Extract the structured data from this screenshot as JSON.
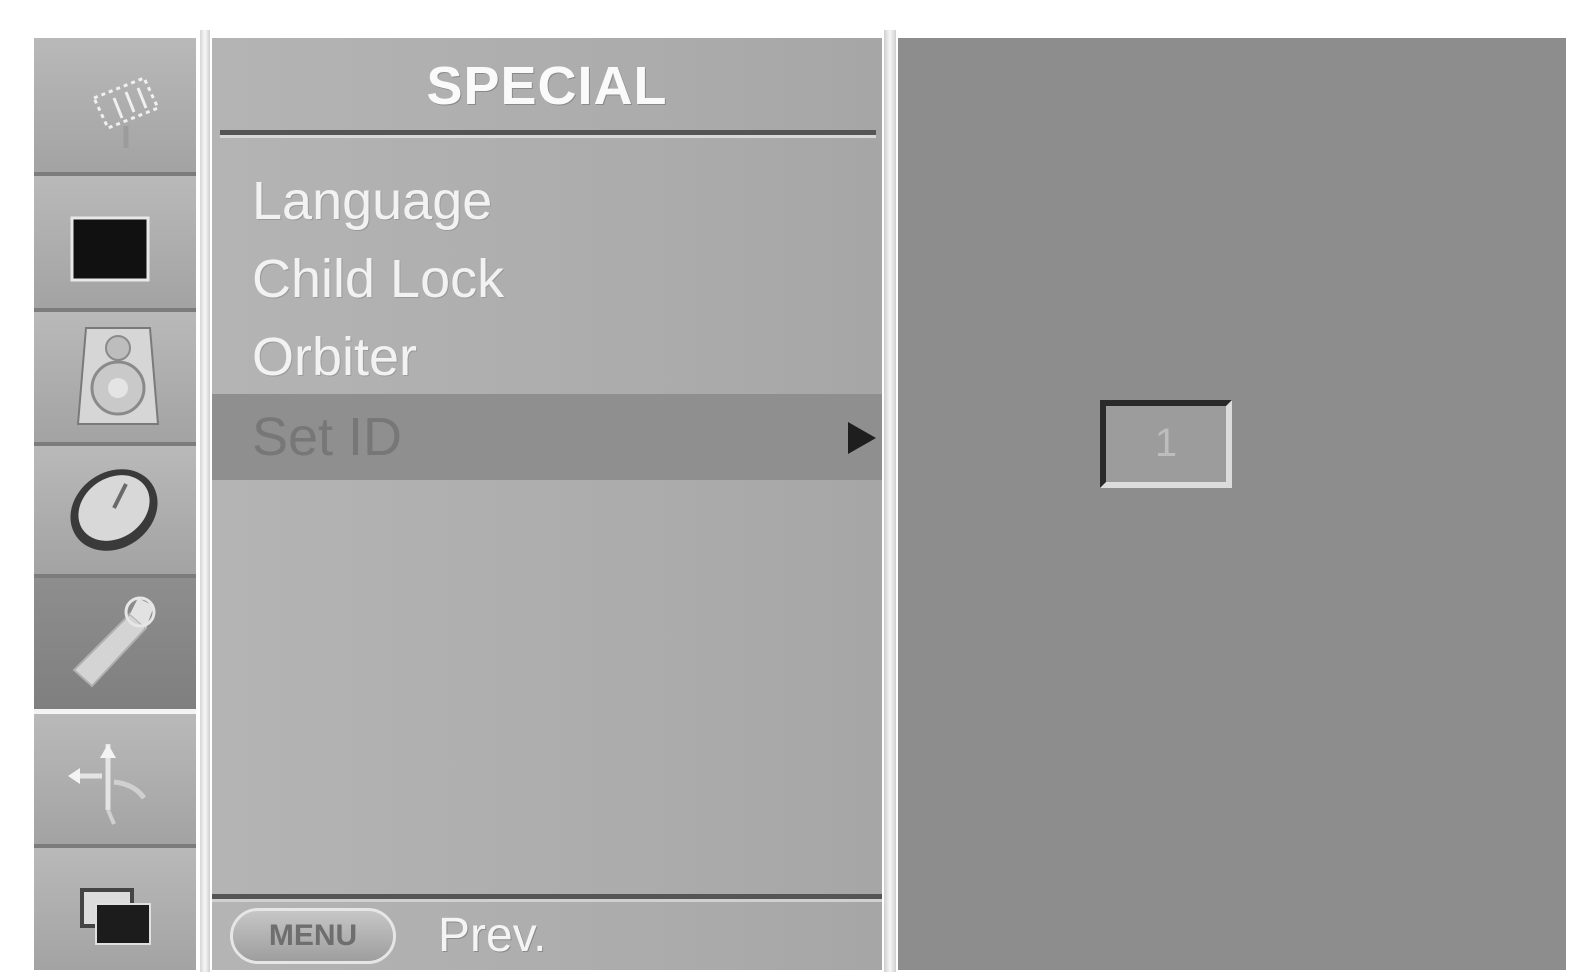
{
  "sidebar": {
    "icons": [
      {
        "name": "antenna-icon",
        "active": false
      },
      {
        "name": "picture-icon",
        "active": false
      },
      {
        "name": "speaker-icon",
        "active": false
      },
      {
        "name": "clock-icon",
        "active": false
      },
      {
        "name": "special-tools-icon",
        "active": true
      },
      {
        "name": "screen-adjust-icon",
        "active": false
      },
      {
        "name": "pip-icon",
        "active": false
      }
    ]
  },
  "menu": {
    "title": "SPECIAL",
    "items": [
      {
        "label": "Language"
      },
      {
        "label": "Child Lock"
      },
      {
        "label": "Orbiter"
      },
      {
        "label": "Set ID",
        "selected": true
      }
    ],
    "footer": {
      "button_label": "MENU",
      "action_label": "Prev."
    }
  },
  "set_id": {
    "value": "1"
  },
  "colors": {
    "panel": "#ababab",
    "selected_row": "#8f8f8f",
    "right_panel": "#8d8d8d",
    "title_text": "#fafafa"
  }
}
